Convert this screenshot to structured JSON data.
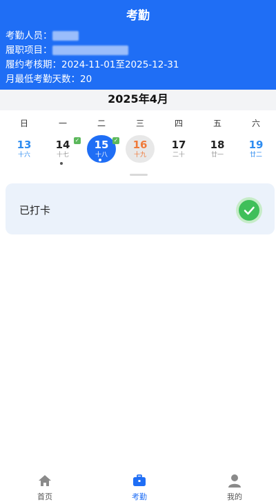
{
  "header": {
    "title": "考勤",
    "staff_label": "考勤人员：",
    "project_label": "履职项目：",
    "period": "履约考核期：2024-11-01至2025-12-31",
    "min_days": "月最低考勤天数：20"
  },
  "calendar": {
    "month_title": "2025年4月",
    "weekdays": [
      "日",
      "一",
      "二",
      "三",
      "四",
      "五",
      "六"
    ],
    "days": [
      {
        "num": "13",
        "lunar": "十六"
      },
      {
        "num": "14",
        "lunar": "十七"
      },
      {
        "num": "15",
        "lunar": "十八"
      },
      {
        "num": "16",
        "lunar": "十九"
      },
      {
        "num": "17",
        "lunar": "二十"
      },
      {
        "num": "18",
        "lunar": "廿一"
      },
      {
        "num": "19",
        "lunar": "廿二"
      }
    ]
  },
  "status_card": {
    "label": "已打卡",
    "icon": "check-circle-icon"
  },
  "tabs": [
    {
      "label": "首页",
      "icon": "home-icon"
    },
    {
      "label": "考勤",
      "icon": "briefcase-icon"
    },
    {
      "label": "我的",
      "icon": "user-icon"
    }
  ],
  "colors": {
    "primary": "#1f6ef5",
    "success": "#3fbf5a",
    "weekend": "#2e8cf0",
    "today": "#f07a3a"
  }
}
